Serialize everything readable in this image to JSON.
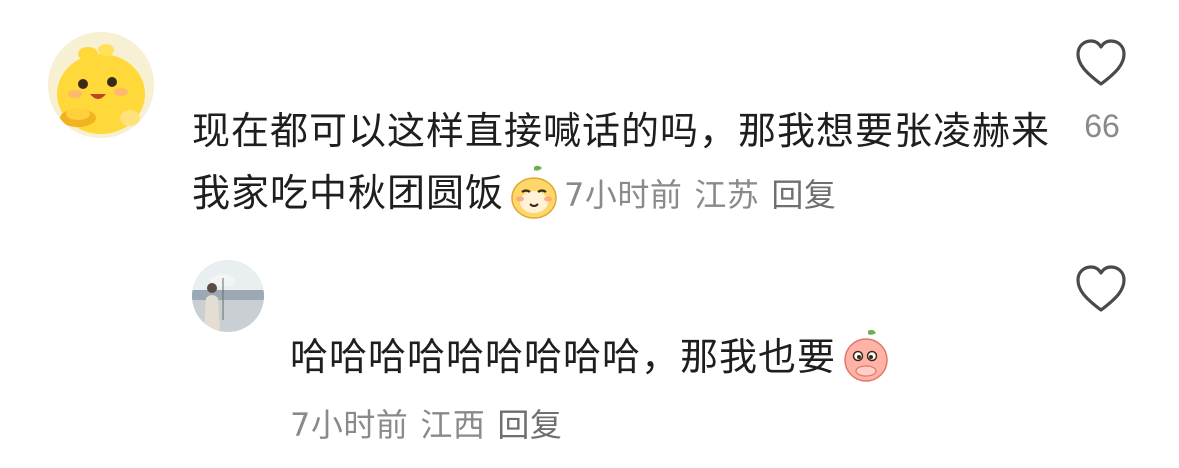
{
  "comment1": {
    "text": "现在都可以这样直接喊话的吗，那我想要张凌赫来我家吃中秋团圆饭",
    "time": "7小时前",
    "location": "江苏",
    "reply": "回复",
    "likes": "66",
    "emoji": "pear-blush-emoji"
  },
  "comment2": {
    "text": "哈哈哈哈哈哈哈哈哈，那我也要",
    "time": "7小时前",
    "location": "江西",
    "reply": "回复",
    "emoji": "peach-shy-emoji"
  },
  "icons": {
    "like": "heart-outline-icon"
  }
}
